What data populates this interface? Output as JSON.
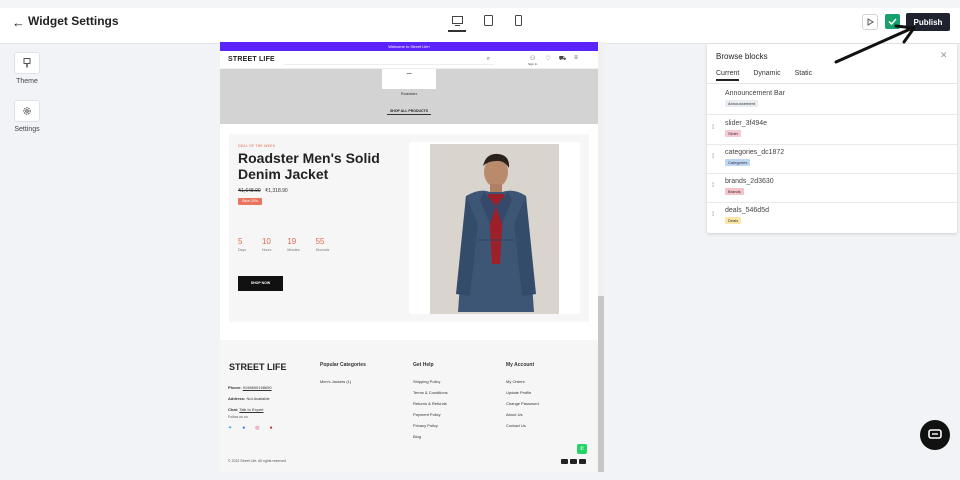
{
  "header": {
    "back_icon": "arrow-left-icon",
    "title": "Widget Settings",
    "devices": [
      "desktop-icon",
      "tablet-icon",
      "mobile-icon"
    ],
    "publish_label": "Publish"
  },
  "rail": {
    "items": [
      {
        "label": "Theme",
        "icon": "brush-icon"
      },
      {
        "label": "Settings",
        "icon": "gear-icon"
      }
    ]
  },
  "preview": {
    "announcement": "Welcome to Street Life!",
    "brand": "STREET LIFE",
    "nav_signin": "Sign In",
    "hero": {
      "card_text": "—",
      "card_label": "Roadster",
      "shop_all": "SHOP ALL PRODUCTS"
    },
    "deal": {
      "tag": "DEAL OF THE WEEK",
      "name": "Roadster Men's Solid Denim Jacket",
      "old_price": "₹1,648.90",
      "price": "₹1,318.90",
      "save": "Save 20%",
      "timer": [
        {
          "num": "5",
          "unit": "Days"
        },
        {
          "num": "10",
          "unit": "Hours"
        },
        {
          "num": "19",
          "unit": "Minutes"
        },
        {
          "num": "55",
          "unit": "Seconds"
        }
      ],
      "cta": "SHOP NOW"
    },
    "footer": {
      "brand": "STREET LIFE",
      "phone_label": "Phone:",
      "phone": "9198690198690",
      "address_label": "Address:",
      "address": "Not Available",
      "chat_label": "Chat:",
      "chat": "Talk to Expert",
      "follow": "Follow us on",
      "col1_title": "Popular Categories",
      "col1_items": [
        "Men's Jackets (1)"
      ],
      "col2_title": "Get Help",
      "col2_items": [
        "Shipping Policy",
        "Terms & Conditions",
        "Returns & Refunds",
        "Payment Policy",
        "Privacy Policy",
        "Blog"
      ],
      "col3_title": "My Account",
      "col3_items": [
        "My Orders",
        "Update Profile",
        "Change Password",
        "About Us",
        "Contact Us"
      ],
      "copyright": "© 2022 Street Life. All rights reserved"
    }
  },
  "panel": {
    "title": "Browse blocks",
    "tabs": [
      "Current",
      "Dynamic",
      "Static"
    ],
    "blocks": [
      {
        "name": "Announcement Bar",
        "badge": "Announcement",
        "color": "#e9ecf0"
      },
      {
        "name": "slider_3f494e",
        "badge": "Slider",
        "color": "#f8c9d4"
      },
      {
        "name": "categories_dc1872",
        "badge": "Categories",
        "color": "#bcd6f3"
      },
      {
        "name": "brands_2d3630",
        "badge": "Brands",
        "color": "#f5c2c8"
      },
      {
        "name": "deals_546d5d",
        "badge": "Deals",
        "color": "#fbe6a6"
      }
    ]
  },
  "colors": {
    "announcement_bg": "#5b24ff",
    "publish_bg": "#1f2330",
    "check_bg": "#1aa06d",
    "deal_accent": "#e0684b"
  }
}
